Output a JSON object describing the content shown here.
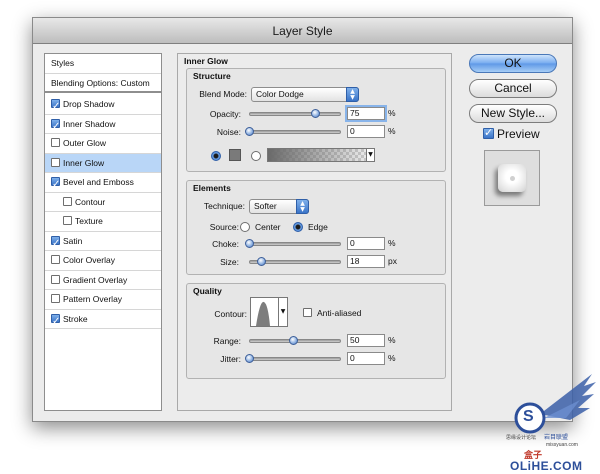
{
  "window": {
    "title": "Layer Style"
  },
  "styles_list": {
    "header": "Styles",
    "blending_options": "Blending Options: Custom",
    "items": [
      {
        "label": "Drop Shadow",
        "checked": true,
        "selected": false,
        "indent": false
      },
      {
        "label": "Inner Shadow",
        "checked": true,
        "selected": false,
        "indent": false
      },
      {
        "label": "Outer Glow",
        "checked": false,
        "selected": false,
        "indent": false
      },
      {
        "label": "Inner Glow",
        "checked": false,
        "selected": true,
        "indent": false
      },
      {
        "label": "Bevel and Emboss",
        "checked": true,
        "selected": false,
        "indent": false
      },
      {
        "label": "Contour",
        "checked": false,
        "selected": false,
        "indent": true
      },
      {
        "label": "Texture",
        "checked": false,
        "selected": false,
        "indent": true
      },
      {
        "label": "Satin",
        "checked": true,
        "selected": false,
        "indent": false
      },
      {
        "label": "Color Overlay",
        "checked": false,
        "selected": false,
        "indent": false
      },
      {
        "label": "Gradient Overlay",
        "checked": false,
        "selected": false,
        "indent": false
      },
      {
        "label": "Pattern Overlay",
        "checked": false,
        "selected": false,
        "indent": false
      },
      {
        "label": "Stroke",
        "checked": true,
        "selected": false,
        "indent": false
      }
    ]
  },
  "panel": {
    "title": "Inner Glow",
    "structure": {
      "title": "Structure",
      "blend_mode_label": "Blend Mode:",
      "blend_mode_value": "Color Dodge",
      "opacity_label": "Opacity:",
      "opacity_value": "75",
      "opacity_level": 0.75,
      "opacity_unit": "%",
      "noise_label": "Noise:",
      "noise_value": "0",
      "noise_level": 0,
      "noise_unit": "%"
    },
    "elements": {
      "title": "Elements",
      "technique_label": "Technique:",
      "technique_value": "Softer",
      "source_label": "Source:",
      "source_center": "Center",
      "source_edge": "Edge",
      "source_selected": "Edge",
      "choke_label": "Choke:",
      "choke_value": "0",
      "choke_level": 0,
      "choke_unit": "%",
      "size_label": "Size:",
      "size_value": "18",
      "size_unit": "px"
    },
    "quality": {
      "title": "Quality",
      "contour_label": "Contour:",
      "anti_aliased_label": "Anti-aliased",
      "anti_aliased_checked": false,
      "range_label": "Range:",
      "range_value": "50",
      "range_level": 0.5,
      "range_unit": "%",
      "jitter_label": "Jitter:",
      "jitter_value": "0",
      "jitter_level": 0,
      "jitter_unit": "%"
    }
  },
  "buttons": {
    "ok": "OK",
    "cancel": "Cancel",
    "new_style": "New Style...",
    "preview_label": "Preview",
    "preview_checked": true
  },
  "watermark": {
    "line1": "思缘设计论坛",
    "line2": "missyuan.com",
    "line3": "OLiHE.COM",
    "badge": "S",
    "bottom_cn": "盒子",
    "cn_top": "岩目联盟"
  },
  "colors": {
    "accent": "#3a74c8",
    "selection": "#b9d6f7",
    "window_bg": "#ececec",
    "watermark_blue": "#2d4f9a"
  }
}
